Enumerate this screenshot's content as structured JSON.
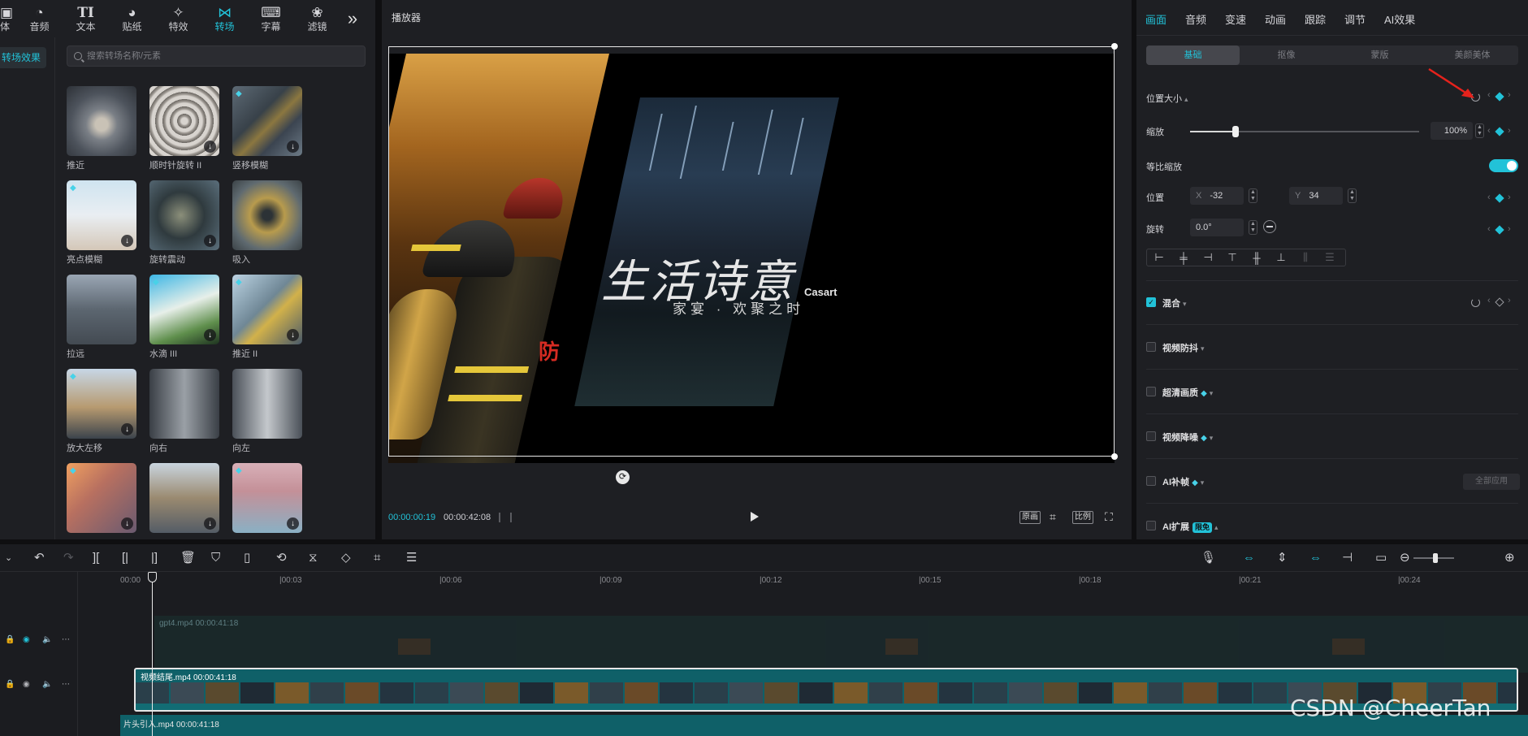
{
  "top_toolbar": {
    "items": [
      {
        "icon": "media-icon",
        "label": "体"
      },
      {
        "icon": "audio-icon",
        "label": "音频"
      },
      {
        "icon": "text-icon",
        "label": "文本",
        "glyph": "TI"
      },
      {
        "icon": "sticker-icon",
        "label": "贴纸"
      },
      {
        "icon": "effects-icon",
        "label": "特效"
      },
      {
        "icon": "transition-icon",
        "label": "转场"
      },
      {
        "icon": "caption-icon",
        "label": "字幕"
      },
      {
        "icon": "filter-icon",
        "label": "滤镜"
      }
    ],
    "active": "转场",
    "more_icon": "chevron-double-right-icon"
  },
  "sidebar": {
    "active_item": "转场效果"
  },
  "search": {
    "placeholder": "搜索转场名称/元素"
  },
  "effects": [
    {
      "name": "推近",
      "download": false,
      "vip": false
    },
    {
      "name": "顺时针旋转 II",
      "download": true,
      "vip": false
    },
    {
      "name": "竖移模糊",
      "download": true,
      "vip": true
    },
    {
      "name": "亮点模糊",
      "download": true,
      "vip": true
    },
    {
      "name": "旋转震动",
      "download": true,
      "vip": false
    },
    {
      "name": "吸入",
      "download": false,
      "vip": false
    },
    {
      "name": "拉远",
      "download": false,
      "vip": false
    },
    {
      "name": "水滴 III",
      "download": true,
      "vip": true
    },
    {
      "name": "推近 II",
      "download": true,
      "vip": true
    },
    {
      "name": "放大左移",
      "download": true,
      "vip": true
    },
    {
      "name": "向右",
      "download": false,
      "vip": false
    },
    {
      "name": "向左",
      "download": false,
      "vip": false
    },
    {
      "name": "",
      "download": true,
      "vip": true
    },
    {
      "name": "",
      "download": true,
      "vip": false
    },
    {
      "name": "",
      "download": true,
      "vip": true
    }
  ],
  "player": {
    "title": "播放器",
    "current_time": "00:00:00:19",
    "total_time": "00:00:42:08",
    "buttons": {
      "original": "原画",
      "ratio": "比例"
    },
    "preview_text": {
      "poem": "生活诗意",
      "sub": "家宴 · 欢聚之时",
      "brand": "Casart",
      "fang": "防"
    }
  },
  "inspector": {
    "tabs": [
      "画面",
      "音频",
      "变速",
      "动画",
      "跟踪",
      "调节",
      "AI效果"
    ],
    "active_tab": "画面",
    "sub_tabs": [
      "基础",
      "抠像",
      "蒙版",
      "美颜美体"
    ],
    "active_sub_tab": "基础",
    "position_size": "位置大小",
    "scale_label": "缩放",
    "scale_value": "100%",
    "scale_fraction": 0.18,
    "uniform_scale": "等比缩放",
    "uniform_scale_on": true,
    "position_label": "位置",
    "pos_x_prefix": "X",
    "pos_x": "-32",
    "pos_y_prefix": "Y",
    "pos_y": "34",
    "rotation_label": "旋转",
    "rotation_value": "0.0°",
    "sections": {
      "blend": "混合",
      "stabilize": "视频防抖",
      "hd": "超清画质",
      "denoise": "视频降噪",
      "ai_frame": "AI补帧",
      "ai_expand": "AI扩展"
    },
    "apply_all": "全部应用",
    "new_badge": "限免"
  },
  "timeline": {
    "ruler": [
      "00:00",
      "|00:03",
      "|00:06",
      "|00:09",
      "|00:12",
      "|00:15",
      "|00:18",
      "|00:21",
      "|00:24"
    ],
    "clip_top": "gpt4.mp4   00:00:41:18",
    "clip_main": "视频结尾.mp4   00:00:41:18",
    "clip_bottom": "片头引入.mp4   00:00:41:18"
  },
  "watermark": "CSDN @CheerTan"
}
